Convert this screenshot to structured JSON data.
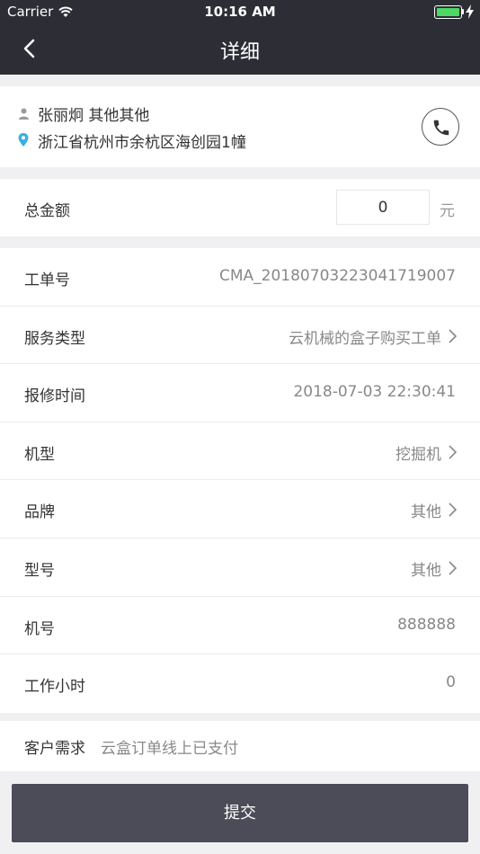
{
  "status_bar": {
    "carrier": "Carrier",
    "time": "10:16 AM",
    "battery_color": "#4cd964"
  },
  "nav": {
    "title": "详细",
    "back_icon": "chevron-left-icon"
  },
  "contact": {
    "name": "张丽炯 其他其他",
    "address": "浙江省杭州市余杭区海创园1幢",
    "person_icon": "person-icon",
    "location_icon": "location-pin-icon",
    "phone_icon": "phone-icon"
  },
  "amount": {
    "label": "总金额",
    "value": "0",
    "unit": "元"
  },
  "details": {
    "rows": [
      {
        "label": "工单号",
        "value": "CMA_20180703223041719007",
        "arrow": false
      },
      {
        "label": "服务类型",
        "value": "云机械的盒子购买工单",
        "arrow": true
      },
      {
        "label": "报修时间",
        "value": "2018-07-03 22:30:41",
        "arrow": false
      },
      {
        "label": "机型",
        "value": "挖掘机",
        "arrow": true
      },
      {
        "label": "品牌",
        "value": "其他",
        "arrow": true
      },
      {
        "label": "型号",
        "value": "其他",
        "arrow": true
      },
      {
        "label": "机号",
        "value": "888888",
        "arrow": false
      },
      {
        "label": "工作小时",
        "value": "0",
        "arrow": false
      }
    ]
  },
  "demand": {
    "label": "客户需求",
    "value": "云盒订单线上已支付"
  },
  "submit": {
    "label": "提交"
  },
  "colors": {
    "header_bg": "#2d2e35",
    "submit_bg": "#4b4c57",
    "page_bg": "#f0f0f2",
    "pin_color": "#3ab0e2"
  }
}
